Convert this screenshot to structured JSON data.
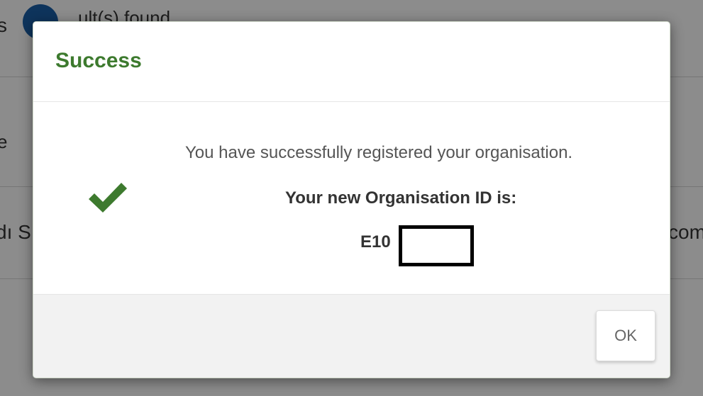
{
  "background": {
    "top_left_text": "s",
    "top_text": "ult(s) found",
    "row2_left_text": "e",
    "row3_left_text": "dı S",
    "row3_right_text": "com"
  },
  "modal": {
    "title": "Success",
    "message": "You have successfully registered your organisation.",
    "id_label": "Your new Organisation ID is:",
    "id_value": "E10",
    "ok_label": "OK"
  },
  "colors": {
    "title_green": "#3d7a2e",
    "check_green": "#3d7a2e"
  },
  "icons": {
    "success": "check-icon"
  }
}
